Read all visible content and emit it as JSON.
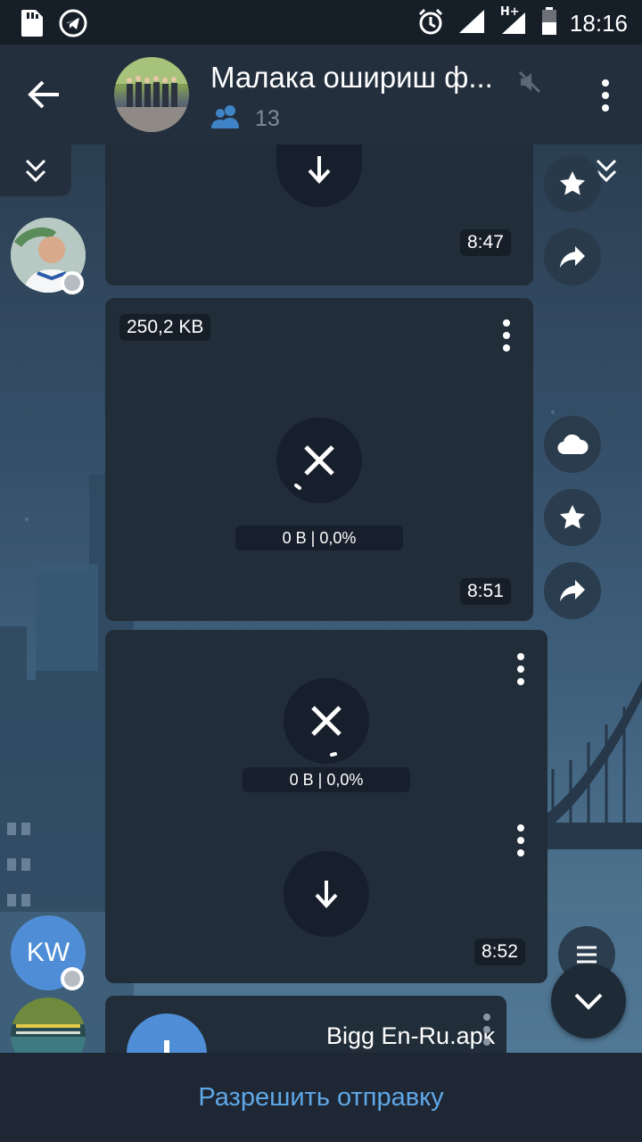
{
  "status_bar": {
    "time": "18:16",
    "network": "H+"
  },
  "header": {
    "title": "Малака ошириш ф...",
    "member_count": "13"
  },
  "messages": [
    {
      "time": "8:47"
    },
    {
      "size": "250,2 KB",
      "progress": "0 B | 0,0%",
      "time": "8:51"
    },
    {
      "progress": "0 B | 0,0%",
      "time": "8:52"
    },
    {
      "file_name": "Bigg En-Ru.apk"
    }
  ],
  "avatars": {
    "kw_initials": "KW"
  },
  "bottom_bar": {
    "action_label": "Разрешить отправку"
  },
  "colors": {
    "accent": "#5fa8e8",
    "header_bg": "#242f3d",
    "bubble_bg": "#222d3a"
  }
}
